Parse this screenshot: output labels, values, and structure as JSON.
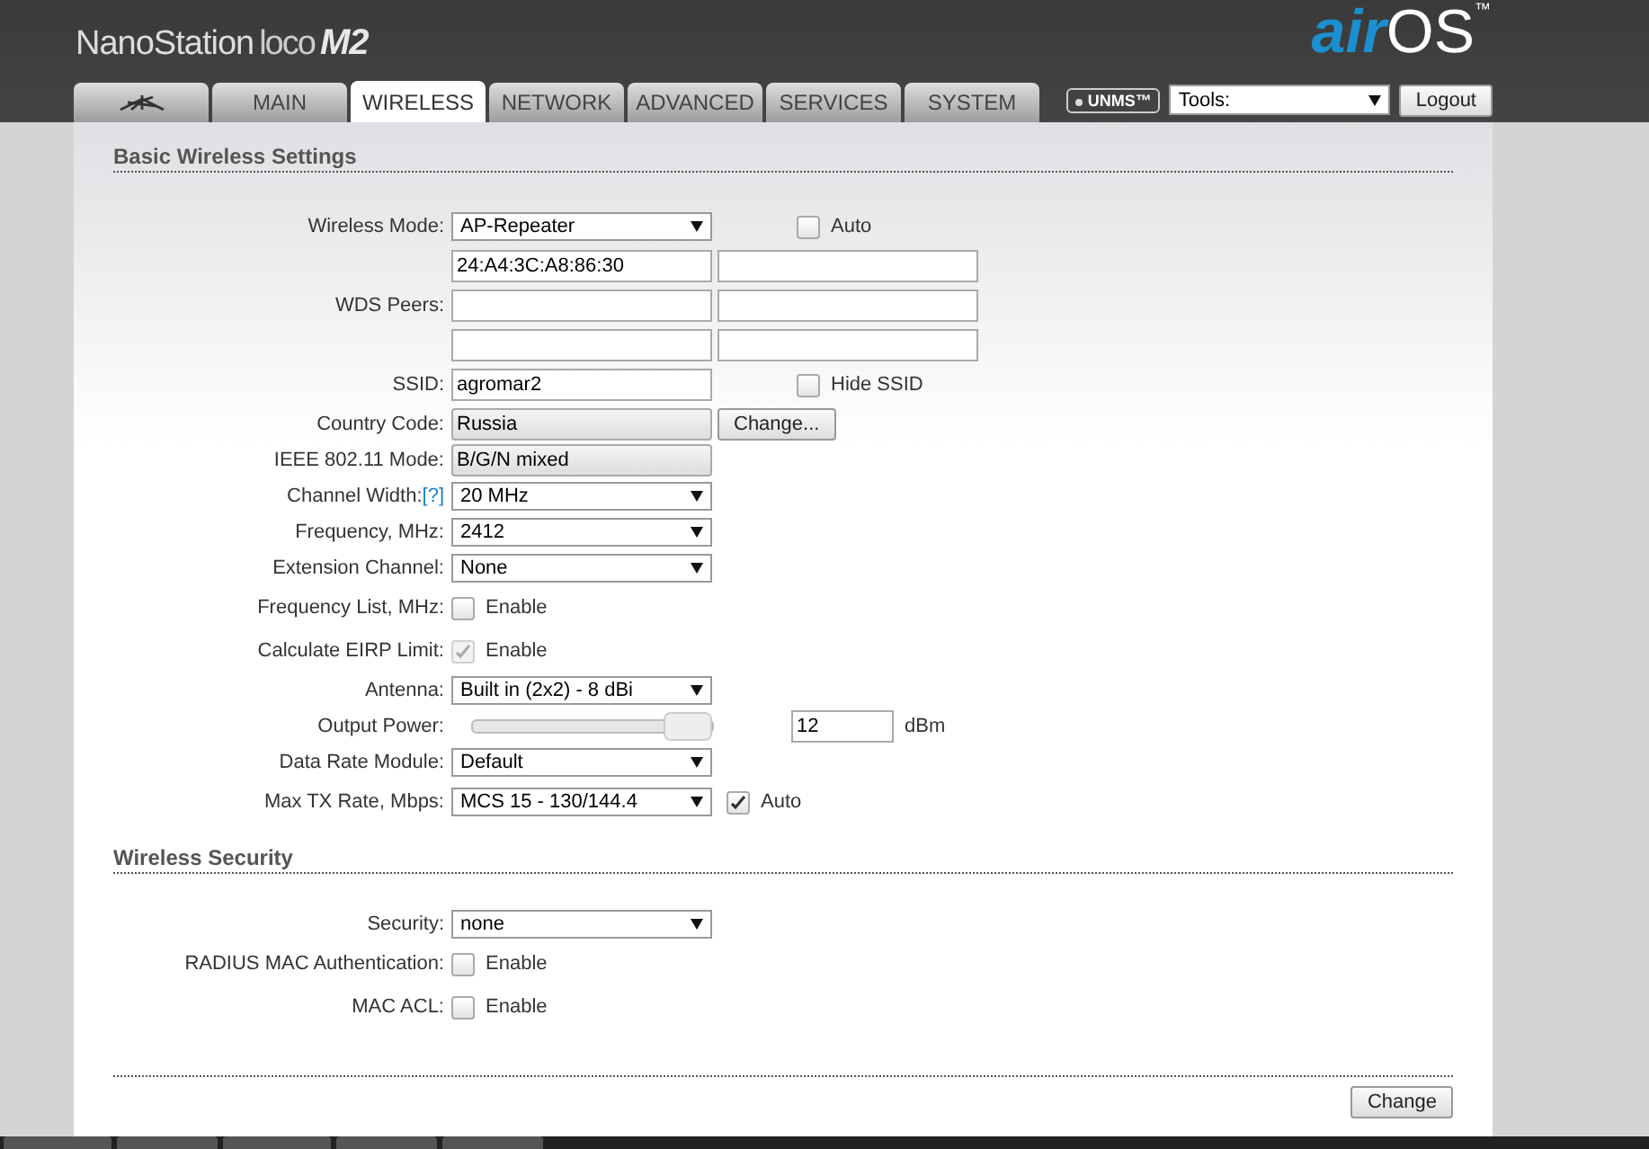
{
  "header": {
    "product": "NanoStation",
    "variant": "loco",
    "model": "M2",
    "brand_prefix": "air",
    "brand_name": "OS",
    "trademark": "™"
  },
  "tabs": [
    {
      "kind": "icon",
      "selected": false
    },
    {
      "kind": "text",
      "label": "MAIN",
      "selected": false
    },
    {
      "kind": "text",
      "label": "WIRELESS",
      "selected": true
    },
    {
      "kind": "text",
      "label": "NETWORK",
      "selected": false
    },
    {
      "kind": "text",
      "label": "ADVANCED",
      "selected": false
    },
    {
      "kind": "text",
      "label": "SERVICES",
      "selected": false
    },
    {
      "kind": "text",
      "label": "SYSTEM",
      "selected": false
    }
  ],
  "toolbar": {
    "badge": "UNMS",
    "badge_mark": "™",
    "tools": "Tools:",
    "logout": "Logout"
  },
  "sections": [
    {
      "title": "Basic Wireless Settings",
      "rows": [
        {
          "label": "Wireless Mode:",
          "kind": "select",
          "value": "AP-Repeater",
          "side": {
            "kind": "checkbox",
            "label": "Auto",
            "checked": false,
            "disabled": false
          }
        },
        {
          "label": "WDS Peers:",
          "kind": "peers",
          "peers": [
            "24:A4:3C:A8:86:30"
          ]
        },
        {
          "label": "SSID:",
          "kind": "text",
          "value": "agromar2",
          "side": {
            "kind": "checkbox",
            "label": "Hide SSID",
            "checked": false,
            "disabled": false
          }
        },
        {
          "label": "Country Code:",
          "kind": "readonly",
          "value": "Russia",
          "side": {
            "kind": "button",
            "label": "Change..."
          }
        },
        {
          "label": "IEEE 802.11 Mode:",
          "kind": "readonly",
          "value": "B/G/N mixed"
        },
        {
          "label": "Channel Width:",
          "help": "[?]",
          "kind": "select",
          "value": "20 MHz"
        },
        {
          "label": "Frequency, MHz:",
          "kind": "select",
          "value": "2412"
        },
        {
          "label": "Extension Channel:",
          "kind": "select",
          "value": "None"
        },
        {
          "label": "Frequency List, MHz:",
          "kind": "checkbox",
          "text": "Enable",
          "checked": false,
          "disabled": false
        },
        {
          "label": "Calculate EIRP Limit:",
          "kind": "checkbox",
          "text": "Enable",
          "checked": true,
          "disabled": true
        },
        {
          "label": "Antenna:",
          "kind": "select",
          "value": "Built in (2x2) - 8 dBi"
        },
        {
          "label": "Output Power:",
          "kind": "slider",
          "level": 1,
          "value": "12",
          "unit": "dBm"
        },
        {
          "label": "Data Rate Module:",
          "kind": "select",
          "value": "Default"
        },
        {
          "label": "Max TX Rate, Mbps:",
          "kind": "select",
          "value": "MCS 15 - 130/144.4",
          "side": {
            "kind": "inline-checkbox",
            "label": "Auto",
            "checked": true,
            "disabled": false
          }
        }
      ]
    },
    {
      "title": "Wireless Security",
      "rows": [
        {
          "label": "Security:",
          "kind": "select",
          "value": "none"
        },
        {
          "label": "RADIUS MAC Authentication:",
          "kind": "checkbox",
          "text": "Enable",
          "checked": false,
          "disabled": false
        },
        {
          "label": "MAC ACL:",
          "kind": "checkbox",
          "text": "Enable",
          "checked": false,
          "disabled": false
        }
      ]
    }
  ],
  "submit": "Change"
}
